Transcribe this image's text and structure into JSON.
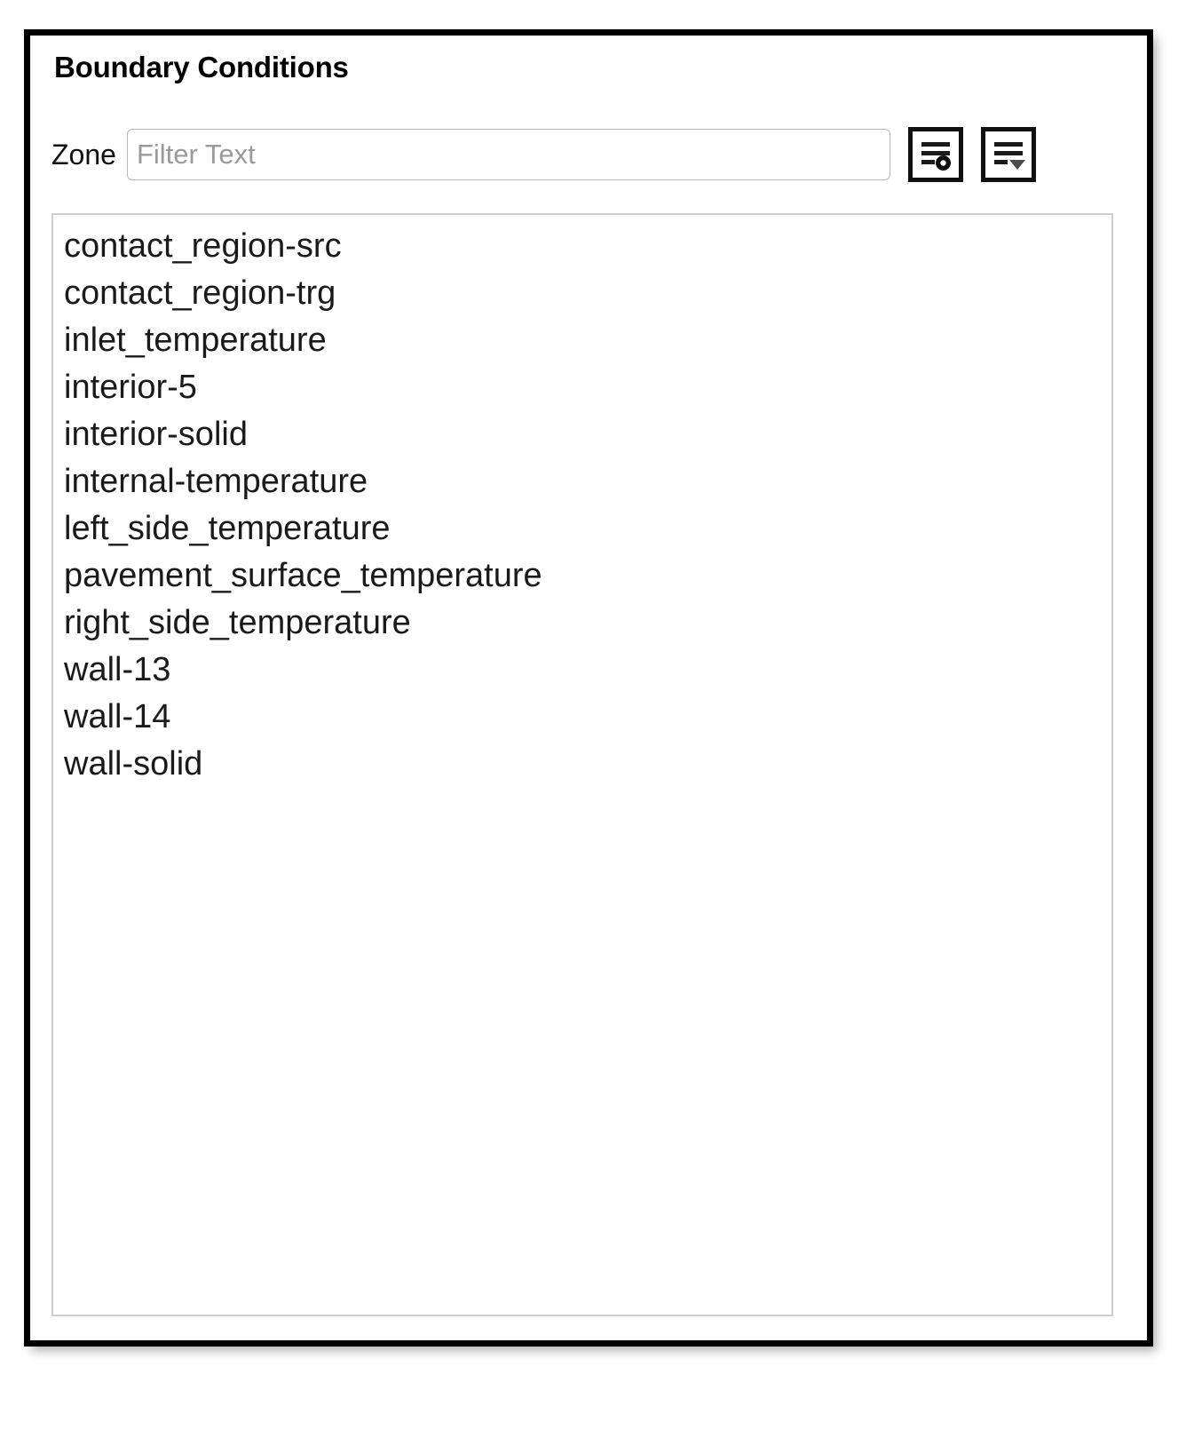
{
  "panel": {
    "title": "Boundary Conditions"
  },
  "filter": {
    "zone_label": "Zone",
    "input_value": "",
    "input_placeholder": "Filter Text",
    "buttons": [
      {
        "name": "list-settings-icon",
        "title": "List Options"
      },
      {
        "name": "list-dropdown-icon",
        "title": "Display Options"
      }
    ]
  },
  "zone_list": {
    "items": [
      "contact_region-src",
      "contact_region-trg",
      "inlet_temperature",
      "interior-5",
      "interior-solid",
      "internal-temperature",
      "left_side_temperature",
      "pavement_surface_temperature",
      "right_side_temperature",
      "wall-13",
      "wall-14",
      "wall-solid"
    ]
  },
  "colors": {
    "panel_border": "#000000",
    "text": "#1a1a1a",
    "placeholder": "#9a9a9a",
    "list_border": "#cfcfcf",
    "input_border": "#b8b8b8"
  }
}
